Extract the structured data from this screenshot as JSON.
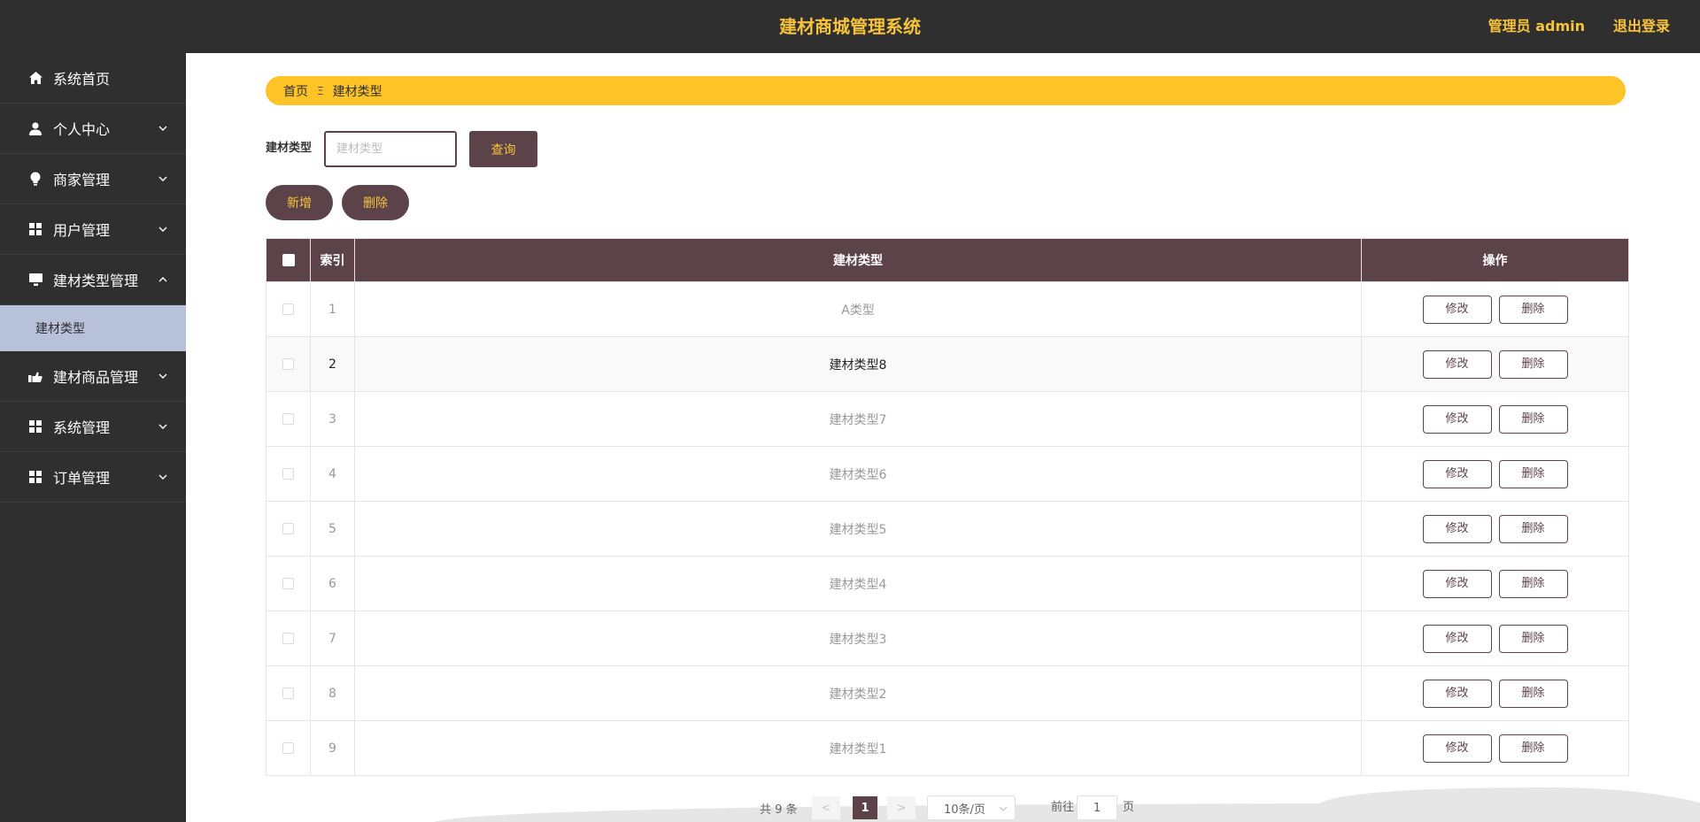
{
  "header": {
    "title": "建材商城管理系统",
    "admin_label": "管理员 admin",
    "logout_label": "退出登录"
  },
  "sidebar": {
    "items": [
      {
        "label": "系统首页",
        "icon": "home-icon"
      },
      {
        "label": "个人中心",
        "icon": "user-icon"
      },
      {
        "label": "商家管理",
        "icon": "bulb-icon"
      },
      {
        "label": "用户管理",
        "icon": "grid-icon"
      },
      {
        "label": "建材类型管理",
        "icon": "monitor-icon"
      },
      {
        "label": "建材类型"
      },
      {
        "label": "建材商品管理",
        "icon": "hand-icon"
      },
      {
        "label": "系统管理",
        "icon": "grid-icon"
      },
      {
        "label": "订单管理",
        "icon": "grid-icon"
      }
    ]
  },
  "breadcrumb": {
    "home": "首页",
    "separator": "Ξ",
    "current": "建材类型"
  },
  "search": {
    "label": "建材类型",
    "placeholder": "建材类型",
    "query_button": "查询"
  },
  "actions": {
    "add": "新增",
    "delete": "删除"
  },
  "table": {
    "headers": {
      "index": "索引",
      "type": "建材类型",
      "ops": "操作"
    },
    "edit_label": "修改",
    "delete_label": "删除",
    "rows": [
      {
        "index": "1",
        "name": "A类型"
      },
      {
        "index": "2",
        "name": "建材类型8"
      },
      {
        "index": "3",
        "name": "建材类型7"
      },
      {
        "index": "4",
        "name": "建材类型6"
      },
      {
        "index": "5",
        "name": "建材类型5"
      },
      {
        "index": "6",
        "name": "建材类型4"
      },
      {
        "index": "7",
        "name": "建材类型3"
      },
      {
        "index": "8",
        "name": "建材类型2"
      },
      {
        "index": "9",
        "name": "建材类型1"
      }
    ]
  },
  "pagination": {
    "total": "共 9 条",
    "prev": "<",
    "current": "1",
    "next": ">",
    "page_size": "10条/页",
    "goto_label": "前往",
    "goto_value": "1",
    "goto_suffix": "页"
  },
  "colors": {
    "primary": "#5c434a",
    "accent": "#fec427",
    "sidebar_bg": "#2f2f2f",
    "active_sub_bg": "#b7c1d9"
  }
}
